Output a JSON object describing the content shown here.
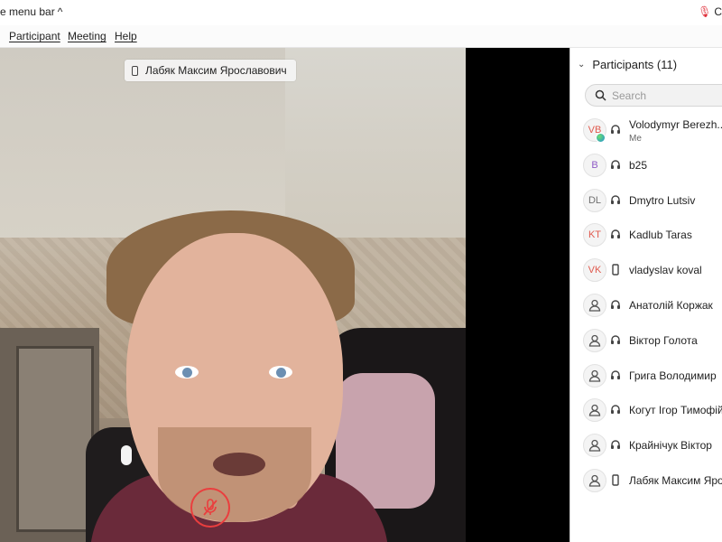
{
  "topbar": {
    "hide_menu_label": "e menu bar",
    "right_text": "C"
  },
  "menubar": {
    "items": [
      "Participant",
      "Meeting",
      "Help"
    ]
  },
  "video": {
    "name_tag": "Лабяк Максим Ярославович"
  },
  "panel": {
    "title": "Participants (11)",
    "search_placeholder": "Search",
    "participants": [
      {
        "initials": "VB",
        "name": "Volodymyr Berezh...",
        "sub": "Me",
        "device": "headset",
        "color": "#e05b4f"
      },
      {
        "initials": "B",
        "name": "b25",
        "device": "headset",
        "color": "#8e5ac6"
      },
      {
        "initials": "DL",
        "name": "Dmytro Lutsiv",
        "device": "headset",
        "color": "#707070"
      },
      {
        "initials": "KT",
        "name": "Kadlub Taras",
        "device": "headset",
        "color": "#e05b4f"
      },
      {
        "initials": "VK",
        "name": "vladyslav koval",
        "device": "phone",
        "color": "#e05b4f"
      },
      {
        "initials": "",
        "name": "Анатолій Коржак",
        "device": "headset"
      },
      {
        "initials": "",
        "name": "Віктор Голота",
        "device": "headset"
      },
      {
        "initials": "",
        "name": "Грига Володимир",
        "device": "headset"
      },
      {
        "initials": "",
        "name": "Когут Ігор Тимофій",
        "device": "headset"
      },
      {
        "initials": "",
        "name": "Крайнічук Віктор",
        "device": "headset"
      },
      {
        "initials": "",
        "name": "Лабяк Максим Ярос",
        "device": "phone"
      }
    ]
  }
}
